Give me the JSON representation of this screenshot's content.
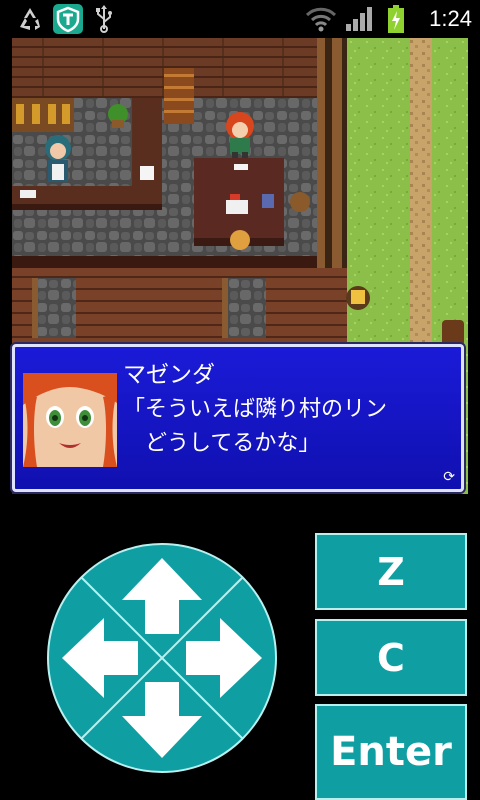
{
  "status_bar": {
    "icons": [
      "recycle-icon",
      "shield-t-icon",
      "usb-icon"
    ],
    "right_icons": [
      "wifi-icon",
      "signal-icon",
      "battery-charging-icon"
    ],
    "time": "1:24"
  },
  "dialog": {
    "speaker": "マゼンダ",
    "line1": "「そういえば隣り村のリン",
    "line2": "　どうしてるかな」",
    "more_glyph": "⟳"
  },
  "controls": {
    "dpad_icons": [
      "arrow-up-icon",
      "arrow-left-icon",
      "arrow-right-icon",
      "arrow-down-icon"
    ],
    "z_label": "Z",
    "c_label": "C",
    "enter_label": "Enter"
  },
  "colors": {
    "dpad": "#0f9fa3",
    "dialog_blue": "#1414c8",
    "key_border": "#b8f0f0"
  }
}
